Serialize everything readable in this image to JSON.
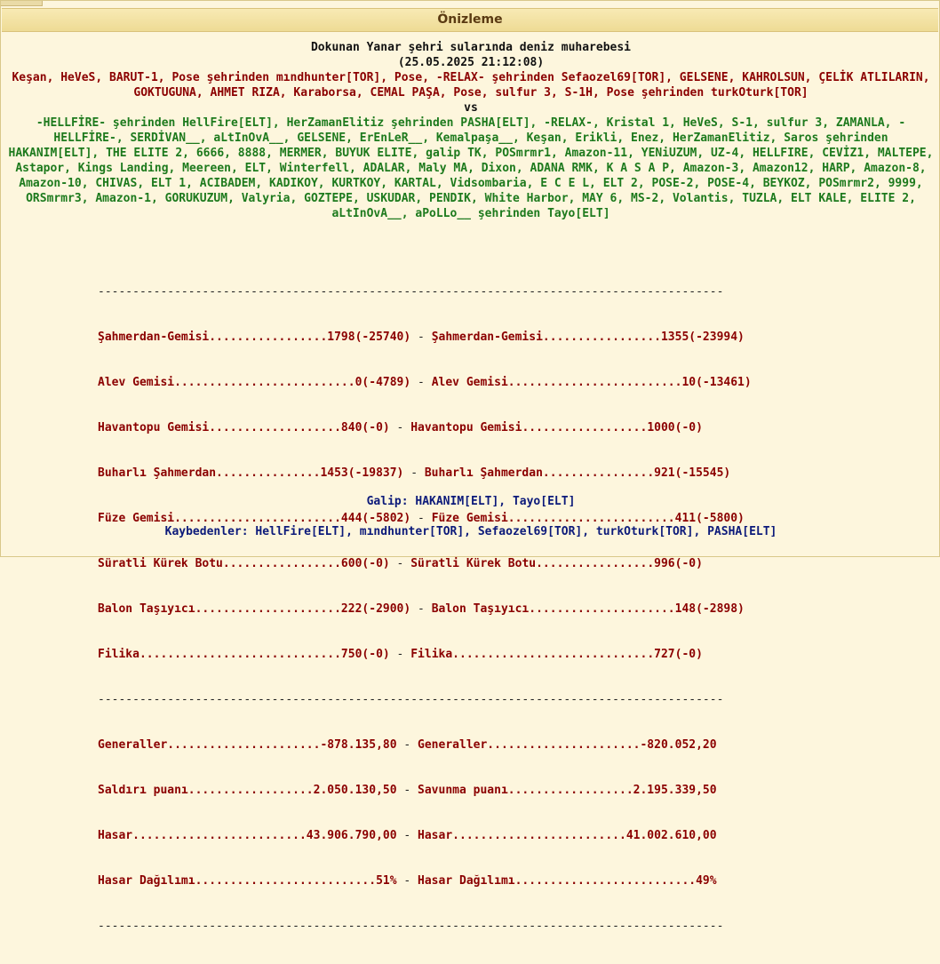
{
  "header": {
    "title": "Önizleme"
  },
  "battle": {
    "title": "Dokunan Yanar şehri sularında deniz muharebesi",
    "date": "(25.05.2025 21:12:08)",
    "attackers": "Keşan, HeVeS, BARUT-1, Pose şehrinden mındhunter[TOR], Pose, -RELAX- şehrinden Sefaozel69[TOR], GELSENE, KAHROLSUN, ÇELİK ATLILARIN, GOKTUGUNA, AHMET RIZA, Karaborsa, CEMAL PAŞA, Pose, sulfur 3, S-1H, Pose şehrinden turkOturk[TOR]",
    "vs": "vs",
    "defenders": "-HELLFİRE- şehrinden HellFire[ELT], HerZamanElitiz şehrinden PASHA[ELT], -RELAX-, Kristal 1, HeVeS, S-1, sulfur 3, ZAMANLA, -HELLFİRE-, SERDİVAN__, aLtInOvA__, GELSENE, ErEnLeR__, Kemalpaşa__, Keşan, Erikli, Enez, HerZamanElitiz, Saros şehrinden HAKANIM[ELT], THE ELITE 2, 6666, 8888, MERMER, BUYUK ELITE, galip TK, POSmrmr1, Amazon-11, YENiUZUM, UZ-4, HELLFIRE, CEVİZ1, MALTEPE, Astapor, Kings Landing, Meereen, ELT, Winterfell, ADALAR, Maly MA, Dixon, ADANA RMK, K A S A P, Amazon-3, Amazon12, HARP, Amazon-8, Amazon-10, CHIVAS, ELT 1, ACIBADEM, KADIKOY, KURTKOY, KARTAL, Vidsombaria, E C E L, ELT 2, POSE-2, POSE-4, BEYKOZ, POSmrmr2, 9999, ORSmrmr3, Amazon-1, GORUKUZUM, Valyria, GOZTEPE, USKUDAR, PENDIK, White Harbor, MAY 6, MS-2, Volantis, TUZLA, ELT KALE, ELITE 2, aLtInOvA__, aPoLLo__ şehrinden Tayo[ELT]"
  },
  "separator": "------------------------------------------------------------------------------------------",
  "units": [
    {
      "left": "Şahmerdan-Gemisi.................1798(-25740)",
      "right": "Şahmerdan-Gemisi.................1355(-23994)"
    },
    {
      "left": "Alev Gemisi..........................0(-4789)",
      "right": "Alev Gemisi.........................10(-13461)"
    },
    {
      "left": "Havantopu Gemisi...................840(-0)",
      "right": "Havantopu Gemisi..................1000(-0)"
    },
    {
      "left": "Buharlı Şahmerdan...............1453(-19837)",
      "right": "Buharlı Şahmerdan................921(-15545)"
    },
    {
      "left": "Füze Gemisi........................444(-5802)",
      "right": "Füze Gemisi........................411(-5800)"
    },
    {
      "left": "Süratli Kürek Botu.................600(-0)",
      "right": "Süratli Kürek Botu.................996(-0)"
    },
    {
      "left": "Balon Taşıyıcı.....................222(-2900)",
      "right": "Balon Taşıyıcı.....................148(-2898)"
    },
    {
      "left": "Filika.............................750(-0)",
      "right": "Filika.............................727(-0)"
    }
  ],
  "totals": [
    {
      "left": "Generaller......................-878.135,80",
      "right": "Generaller......................-820.052,20"
    },
    {
      "left": "Saldırı puanı..................2.050.130,50",
      "right": "Savunma puanı..................2.195.339,50"
    },
    {
      "left": "Hasar.........................43.906.790,00",
      "right": "Hasar.........................41.002.610,00"
    },
    {
      "left": "Hasar Dağılımı..........................51%",
      "right": "Hasar Dağılımı..........................49%"
    }
  ],
  "result": {
    "winner": "Galip: HAKANIM[ELT], Tayo[ELT]",
    "losers": "Kaybedenler: HellFire[ELT], mındhunter[TOR], Sefaozel69[TOR], turkOturk[TOR], PASHA[ELT]"
  }
}
